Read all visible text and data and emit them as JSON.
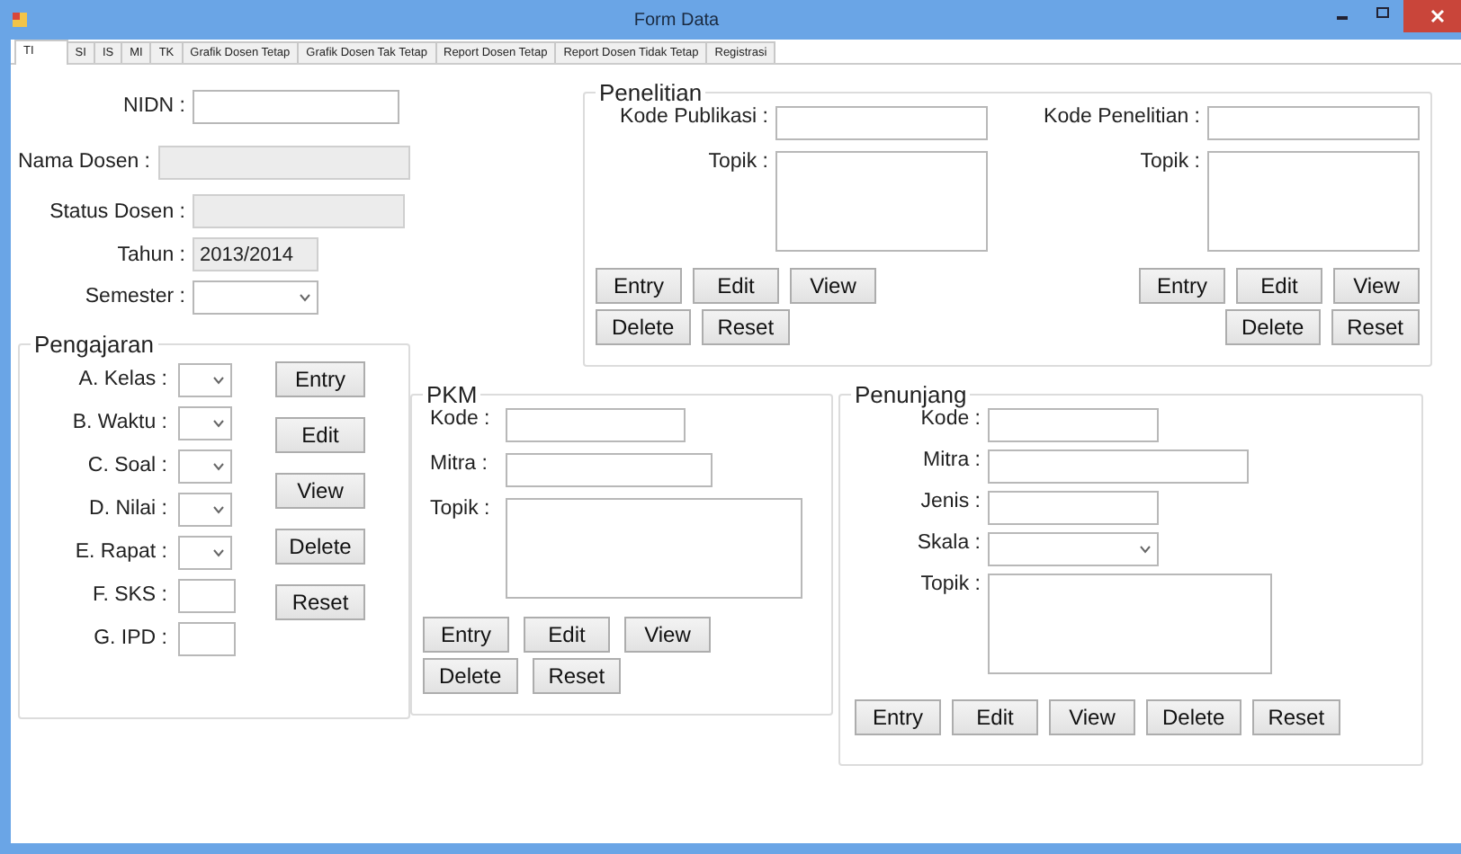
{
  "window": {
    "title": "Form Data"
  },
  "tabs": [
    {
      "label": "TI",
      "selected": true
    },
    {
      "label": "SI",
      "selected": false
    },
    {
      "label": "IS",
      "selected": false
    },
    {
      "label": "MI",
      "selected": false
    },
    {
      "label": "TK",
      "selected": false
    },
    {
      "label": "Grafik Dosen Tetap",
      "selected": false
    },
    {
      "label": "Grafik Dosen Tak Tetap",
      "selected": false
    },
    {
      "label": "Report Dosen Tetap",
      "selected": false
    },
    {
      "label": "Report Dosen Tidak Tetap",
      "selected": false
    },
    {
      "label": "Registrasi",
      "selected": false
    }
  ],
  "dosen_fields": [
    {
      "label": "NIDN :",
      "kind": "text",
      "disabled": false
    },
    {
      "label": "Nama Dosen :",
      "kind": "text",
      "disabled": true
    },
    {
      "label": "Status Dosen :",
      "kind": "text",
      "disabled": true
    },
    {
      "label": "Tahun :",
      "kind": "text",
      "disabled": true,
      "value": "2013/2014"
    },
    {
      "label": "Semester :",
      "kind": "combo",
      "disabled": false
    }
  ],
  "pengajaran": {
    "title": "Pengajaran",
    "fields": [
      {
        "label": "A. Kelas :",
        "kind": "combo"
      },
      {
        "label": "B. Waktu :",
        "kind": "combo"
      },
      {
        "label": "C. Soal :",
        "kind": "combo"
      },
      {
        "label": "D. Nilai :",
        "kind": "combo"
      },
      {
        "label": "E. Rapat :",
        "kind": "combo"
      },
      {
        "label": "F. SKS :",
        "kind": "text"
      },
      {
        "label": "G. IPD :",
        "kind": "text"
      }
    ],
    "buttons": [
      "Entry",
      "Edit",
      "View",
      "Delete",
      "Reset"
    ]
  },
  "penelitian": {
    "title": "Penelitian",
    "sections": [
      {
        "fields": [
          {
            "label": "Kode Publikasi :",
            "kind": "text"
          },
          {
            "label": "Topik :",
            "kind": "multiline"
          }
        ],
        "button_rows": [
          [
            "Entry",
            "Edit",
            "View"
          ],
          [
            "Delete",
            "Reset"
          ]
        ]
      },
      {
        "fields": [
          {
            "label": "Kode Penelitian :",
            "kind": "text"
          },
          {
            "label": "Topik :",
            "kind": "multiline"
          }
        ],
        "button_rows": [
          [
            "Entry",
            "Edit",
            "View"
          ],
          [
            "Delete",
            "Reset"
          ]
        ]
      }
    ]
  },
  "pkm": {
    "title": "PKM",
    "fields": [
      {
        "label": "Kode :",
        "kind": "text"
      },
      {
        "label": "Mitra :",
        "kind": "text"
      },
      {
        "label": "Topik :",
        "kind": "multiline"
      }
    ],
    "button_rows": [
      [
        "Entry",
        "Edit",
        "View"
      ],
      [
        "Delete",
        "Reset"
      ]
    ]
  },
  "penunjang": {
    "title": "Penunjang",
    "fields": [
      {
        "label": "Kode :",
        "kind": "text"
      },
      {
        "label": "Mitra :",
        "kind": "text"
      },
      {
        "label": "Jenis :",
        "kind": "text"
      },
      {
        "label": "Skala :",
        "kind": "combo"
      },
      {
        "label": "Topik :",
        "kind": "multiline"
      }
    ],
    "button_rows": [
      [
        "Entry",
        "Edit",
        "View",
        "Delete",
        "Reset"
      ]
    ]
  }
}
